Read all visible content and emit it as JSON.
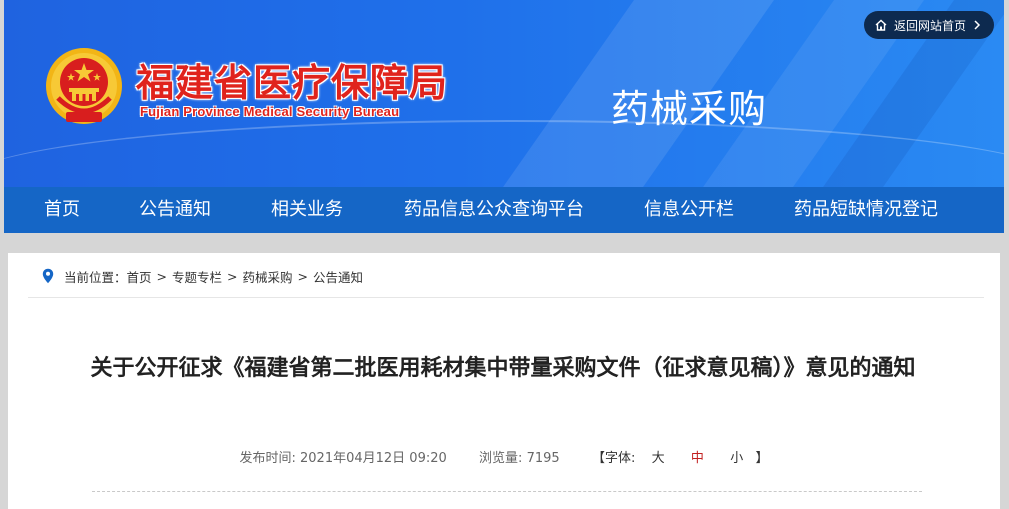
{
  "header": {
    "back_home": "返回网站首页",
    "org_title": "福建省医疗保障局",
    "org_subtitle": "Fujian Province Medical Security Bureau",
    "section": "药械采购"
  },
  "nav": {
    "items": [
      "首页",
      "公告通知",
      "相关业务",
      "药品信息公众查询平台",
      "信息公开栏",
      "药品短缺情况登记"
    ]
  },
  "breadcrumb": {
    "label": "当前位置：",
    "items": [
      "首页",
      "专题专栏",
      "药械采购",
      "公告通知"
    ],
    "separator": ">"
  },
  "article": {
    "title": "关于公开征求《福建省第二批医用耗材集中带量采购文件（征求意见稿）》意见的通知",
    "published_label": "发布时间:",
    "published": "2021年04月12日 09:20",
    "views_label": "浏览量:",
    "views": "7195",
    "font_label": "【字体:",
    "font_large": "大",
    "font_medium": "中",
    "font_small": "小",
    "font_close": "】"
  },
  "colors": {
    "banner": "#1f6ae4",
    "nav": "#1566c6",
    "title_red": "#e0231c",
    "back_home_bg": "#0d2a4f"
  }
}
